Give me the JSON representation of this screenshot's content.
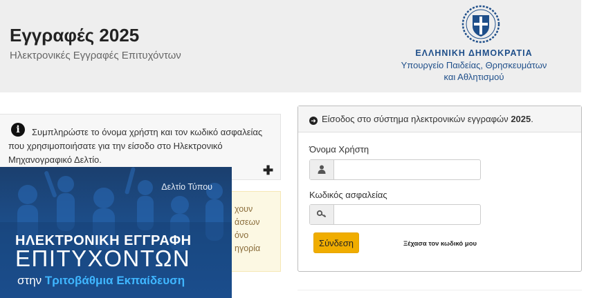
{
  "header": {
    "title": "Εγγραφές 2025",
    "subtitle": "Ηλεκτρονικές Εγγραφές Επιτυχόντων",
    "emblem_icon": "greek-coat-of-arms-icon",
    "country": "ΕΛΛΗΝΙΚΗ ΔΗΜΟΚΡΑΤΙΑ",
    "ministry_line1": "Υπουργείο Παιδείας, Θρησκευμάτων",
    "ministry_line2": "και Αθλητισμού"
  },
  "info_panel": {
    "icon": "info-circle-icon",
    "text": "Συμπληρώστε το όνομα χρήστη και τον κωδικό ασφαλείας που χρησιμοποιήσατε για την είσοδο στο Ηλεκτρονικό Μηχανογραφικό Δελτίο.",
    "expand_icon": "plus-icon"
  },
  "warning_panel": {
    "lines": [
      "χουν",
      "άσεων",
      "όνο",
      "ηγορία"
    ]
  },
  "promo": {
    "press_label": "Δελτίο Τύπου",
    "line1": "ΗΛΕΚΤΡΟΝΙΚΗ ΕΓΓΡΑΦΗ",
    "line2": "ΕΠΙΤΥΧΟΝΤΩΝ",
    "line3_prefix": "στην",
    "line3_highlight": "Τριτοβάθμια Εκπαίδευση"
  },
  "login": {
    "heading_prefix": "Είσοδος στο σύστημα ηλεκτρονικών εγγραφών",
    "heading_year": "2025",
    "heading_suffix": ".",
    "username_label": "Όνομα Χρήστη",
    "username_value": "",
    "username_icon": "user-icon",
    "password_label": "Κωδικός ασφαλείας",
    "password_value": "",
    "password_icon": "key-icon",
    "submit_label": "Σύνδεση",
    "forgot_label": "Ξέχασα τον κωδικό μου"
  },
  "colors": {
    "header_bg": "#eeeeee",
    "ministry_blue": "#1f4f8a",
    "login_button": "#f0ad00",
    "warning_bg": "#fcf8e3",
    "promo_blue": "#1c5190",
    "promo_highlight": "#3fb6ff"
  }
}
